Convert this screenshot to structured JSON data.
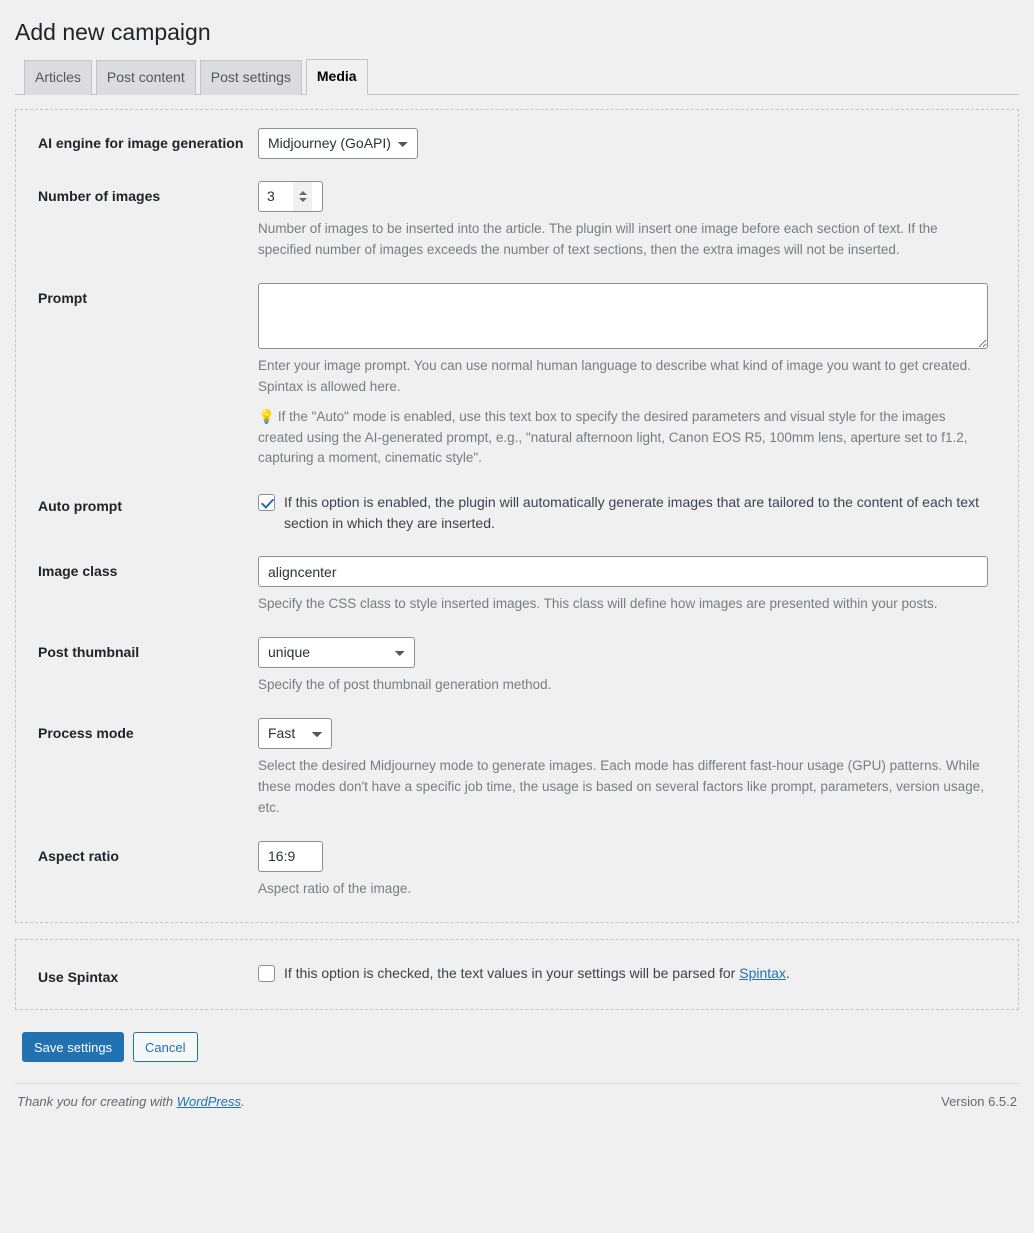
{
  "page": {
    "title": "Add new campaign"
  },
  "tabs": [
    {
      "label": "Articles",
      "active": false
    },
    {
      "label": "Post content",
      "active": false
    },
    {
      "label": "Post settings",
      "active": false
    },
    {
      "label": "Media",
      "active": true
    }
  ],
  "media": {
    "engine": {
      "label": "AI engine for image generation",
      "value": "Midjourney (GoAPI)"
    },
    "number_of_images": {
      "label": "Number of images",
      "value": "3",
      "description": "Number of images to be inserted into the article. The plugin will insert one image before each section of text. If the specified number of images exceeds the number of text sections, then the extra images will not be inserted."
    },
    "prompt": {
      "label": "Prompt",
      "value": "",
      "description": "Enter your image prompt. You can use normal human language to describe what kind of image you want to get created. Spintax is allowed here.",
      "tip_icon": "lightbulb-icon",
      "tip_emoji": "💡",
      "tip": "If the \"Auto\" mode is enabled, use this text box to specify the desired parameters and visual style for the images created using the AI-generated prompt, e.g., \"natural afternoon light, Canon EOS R5, 100mm lens, aperture set to f1.2, capturing a moment, cinematic style\"."
    },
    "auto_prompt": {
      "label": "Auto prompt",
      "checked": true,
      "description": "If this option is enabled, the plugin will automatically generate images that are tailored to the content of each text section in which they are inserted."
    },
    "image_class": {
      "label": "Image class",
      "value": "aligncenter",
      "description": "Specify the CSS class to style inserted images. This class will define how images are presented within your posts."
    },
    "post_thumbnail": {
      "label": "Post thumbnail",
      "value": "unique",
      "description": "Specify the of post thumbnail generation method."
    },
    "process_mode": {
      "label": "Process mode",
      "value": "Fast",
      "description": "Select the desired Midjourney mode to generate images. Each mode has different fast-hour usage (GPU) patterns. While these modes don't have a specific job time, the usage is based on several factors like prompt, parameters, version usage, etc."
    },
    "aspect_ratio": {
      "label": "Aspect ratio",
      "value": "16:9",
      "description": "Aspect ratio of the image."
    }
  },
  "spintax": {
    "label": "Use Spintax",
    "checked": false,
    "text_before": "If this option is checked, the text values in your settings will be parsed for ",
    "link_label": "Spintax",
    "text_after": "."
  },
  "actions": {
    "save_label": "Save settings",
    "cancel_label": "Cancel"
  },
  "footer": {
    "thanks_before": "Thank you for creating with ",
    "wordpress_link": "WordPress",
    "thanks_after": ".",
    "version": "Version 6.5.2"
  },
  "colors": {
    "accent": "#2271b1",
    "background": "#f0f0f1",
    "border": "#c3c4c7",
    "text": "#3c434a",
    "muted": "#787c82"
  }
}
